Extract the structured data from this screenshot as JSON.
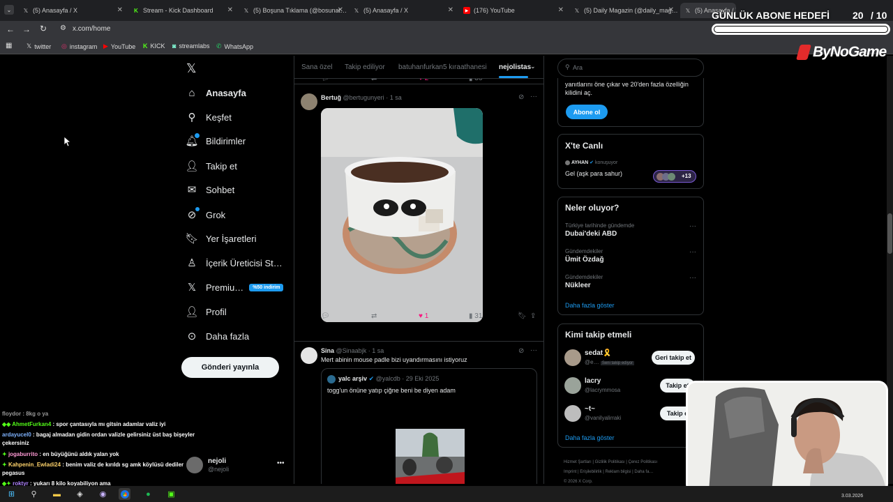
{
  "browser": {
    "tabs": [
      {
        "label": "(5) Anasayfa / X",
        "icon": "x-logo"
      },
      {
        "label": "Stream - Kick Dashboard",
        "icon": "kick-logo"
      },
      {
        "label": "(5) Boşuna Tıklama (@bosunat…",
        "icon": "x-logo"
      },
      {
        "label": "(5) Anasayfa / X",
        "icon": "x-logo"
      },
      {
        "label": "(176) YouTube",
        "icon": "youtube-logo"
      },
      {
        "label": "(5) Daily Magazin (@daily_mag…",
        "icon": "x-logo"
      },
      {
        "label": "(5) Anasayfa / X",
        "icon": "x-logo"
      }
    ],
    "url": "x.com/home",
    "bookmarks": [
      {
        "label": "twitter",
        "icon": "x-logo"
      },
      {
        "label": "instagram",
        "icon": "instagram-logo"
      },
      {
        "label": "YouTube",
        "icon": "youtube-logo"
      },
      {
        "label": "KICK",
        "icon": "kick-logo"
      },
      {
        "label": "streamlabs",
        "icon": "streamlabs-logo"
      },
      {
        "label": "WhatsApp",
        "icon": "whatsapp-logo"
      }
    ]
  },
  "overlay": {
    "goal_title": "GÜNLÜK ABONE HEDEFİ",
    "goal_current": "20",
    "goal_target": "/ 10",
    "brand": "ByNoGame"
  },
  "nav": {
    "items": [
      {
        "label": "Anasayfa",
        "icon": "home-icon"
      },
      {
        "label": "Keşfet",
        "icon": "search-icon"
      },
      {
        "label": "Bildirimler",
        "icon": "bell-icon"
      },
      {
        "label": "Takip et",
        "icon": "follow-icon"
      },
      {
        "label": "Sohbet",
        "icon": "mail-icon"
      },
      {
        "label": "Grok",
        "icon": "grok-icon"
      },
      {
        "label": "Yer İşaretleri",
        "icon": "bookmark-icon"
      },
      {
        "label": "İçerik Üreticisi St…",
        "icon": "creator-icon"
      },
      {
        "label": "Premiu…",
        "icon": "x-premium-icon"
      },
      {
        "label": "Profil",
        "icon": "person-icon"
      },
      {
        "label": "Daha fazla",
        "icon": "more-circle-icon"
      }
    ],
    "premium_badge": "%50 indirim",
    "post_button": "Gönderi yayınla",
    "account": {
      "name": "nejoli",
      "handle": "@nejoli"
    }
  },
  "timeline": {
    "tabs": [
      "Sana özel",
      "Takip ediliyor",
      "batuhanfurkan5 kıraathanesi",
      "nejolistas"
    ],
    "active_tab": "nejolistas",
    "top_actions": {
      "likes": "2",
      "views": "36"
    },
    "post1": {
      "name": "Bertuğ",
      "handle": "@bertugunyeri",
      "time": "· 1 sa",
      "likes": "1",
      "views": "31"
    },
    "post2": {
      "name": "Sina",
      "handle": "@Sinaabjk",
      "time": "· 1 sa",
      "text": "Mert abinin mouse padle bizi uyandırmasını istiyoruz",
      "quote": {
        "name": "yalc arşiv",
        "handle": "@yalcdb",
        "time": "· 29 Eki 2025",
        "text": "togg'un önüne yatıp çiğne beni be diyen adam"
      }
    }
  },
  "sidebar": {
    "search_placeholder": "Ara",
    "premium_text": "yanıtlarını öne çıkar ve 20'den fazla özelliğin kilidini aç.",
    "premium_button": "Abone ol",
    "live": {
      "title": "X'te Canlı",
      "host": "AYHAN",
      "host_status": "konuşuyor",
      "topic": "Gel (aşk para sahur)",
      "listeners": "+13"
    },
    "trends": {
      "title": "Neler oluyor?",
      "items": [
        {
          "context": "Türkiye tarihinde gündemde",
          "name": "Dubai'deki ABD"
        },
        {
          "context": "Gündemdekiler",
          "name": "Ümit Özdağ"
        },
        {
          "context": "Gündemdekiler",
          "name": "Nükleer"
        }
      ],
      "show_more": "Daha fazla göster"
    },
    "who_to_follow": {
      "title": "Kimi takip etmeli",
      "items": [
        {
          "name": "sedat🎗️",
          "handle": "@e…",
          "badge": "Seni takip ediyor",
          "button": "Geri takip et"
        },
        {
          "name": "lacry",
          "handle": "@lacrymmosa",
          "badge": "",
          "button": "Takip et"
        },
        {
          "name": "~t~",
          "handle": "@vanilyalirraki",
          "badge": "",
          "button": "Takip e"
        }
      ],
      "show_more": "Daha fazla göster"
    },
    "footer": [
      "Hizmet Şartları",
      "Gizlilik Politikası",
      "Çerez Politikası",
      "Imprint",
      "Erişilebilirlik",
      "Reklam bilgisi",
      "Daha fa…",
      "© 2026 X Corp."
    ]
  },
  "chat": [
    {
      "user": "floydor",
      "text": ": 8kg o ya",
      "color": "#9a9a9a"
    },
    {
      "user": "AhmetFurkan4",
      "text": ": spor çantasıyla mı gitsin adamlar valiz iyi",
      "color": "#53fc18"
    },
    {
      "user": "ardayucel0",
      "text": ": bagaj almadan gidin ordan valizle gelirsiniz üst baş bişeyler çekersiniz",
      "color": "#7fb3ff"
    },
    {
      "user": "jogaburrito",
      "text": ": en büyüğünü aldık yalan yok",
      "color": "#ff9ad5"
    },
    {
      "user": "Kahpenin_Ewladi24",
      "text": ": benim valiz de kırıldı sg amk köylüsü dediler pegasus",
      "color": "#ffd36b"
    },
    {
      "user": "roktyr",
      "text": ": yukarı 8 kilo koyabiliyon ama",
      "color": "#b084ff"
    }
  ],
  "taskbar": {
    "date": "3.03.2026"
  }
}
